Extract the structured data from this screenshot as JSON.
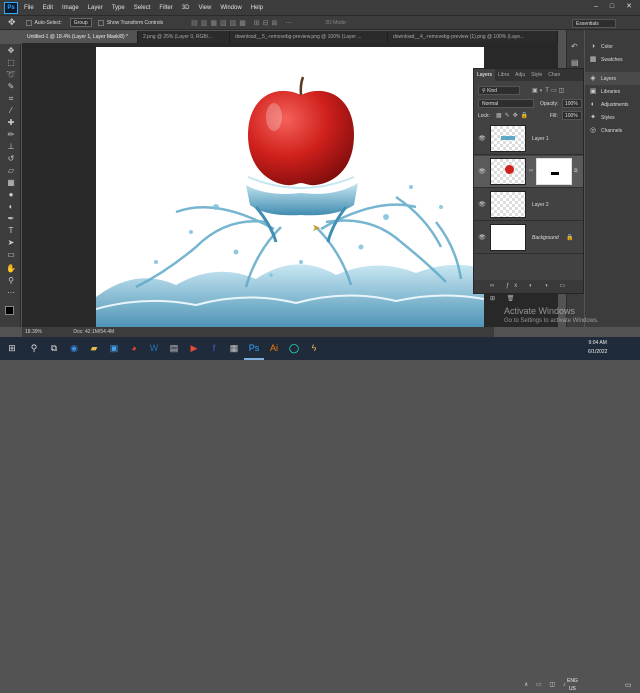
{
  "menubar": {
    "app_badge": "Ps",
    "items": [
      "File",
      "Edit",
      "Image",
      "Layer",
      "Type",
      "Select",
      "Filter",
      "3D",
      "View",
      "Window",
      "Help"
    ]
  },
  "options_bar": {
    "auto_select_label": "Auto-Select:",
    "auto_select_value": "Group",
    "transform_label": "Show Transform Controls",
    "mode_3d_label": "3D Mode:",
    "workspace": "Essentials"
  },
  "tabs": [
    {
      "label": "Untitled-1 @ 18.4% (Layer 1, Layer Mask/8) *",
      "active": true
    },
    {
      "label": "2.png @ 25% (Layer 0, RGB/...",
      "active": false
    },
    {
      "label": "download__5_-removebg-preview.png @ 100% (Layer ...",
      "active": false
    },
    {
      "label": "download__4_-removebg-preview (1).png @ 100% (Laye...",
      "active": false
    }
  ],
  "status": {
    "zoom": "18.39%",
    "doc": "Doc: 42.1M/54.4M"
  },
  "panels": {
    "items": [
      {
        "label": "Color",
        "icon": "color-icon"
      },
      {
        "label": "Swatches",
        "icon": "swatches-icon"
      },
      {
        "label": "Layers",
        "icon": "layers-icon",
        "active": true
      },
      {
        "label": "Libraries",
        "icon": "libraries-icon"
      },
      {
        "label": "Adjustments",
        "icon": "adjustments-icon"
      },
      {
        "label": "Styles",
        "icon": "styles-icon"
      },
      {
        "label": "Channels",
        "icon": "channels-icon"
      }
    ]
  },
  "layers_panel": {
    "tabs": [
      "Layers",
      "Libra",
      "Adju",
      "Style",
      "Chan"
    ],
    "filter": "Kind",
    "blend_mode": "Normal",
    "opacity_label": "Opacity:",
    "opacity": "100%",
    "lock_label": "Lock:",
    "fill_label": "Fill:",
    "fill": "100%",
    "layers": [
      {
        "name": "Layer 1"
      },
      {
        "name": ""
      },
      {
        "name": "Layer 2"
      },
      {
        "name": "Background"
      }
    ]
  },
  "watermark": {
    "line1": "Activate Windows",
    "line2": "Go to Settings to activate Windows."
  },
  "taskbar": {
    "lang": "ENG",
    "region": "US",
    "time": "9:04 AM",
    "date": "6/1/2022"
  },
  "colors": {
    "ps_blue": "#31a8ff",
    "apple_red": "#d0201c",
    "water_blue": "#6fb8d8"
  }
}
